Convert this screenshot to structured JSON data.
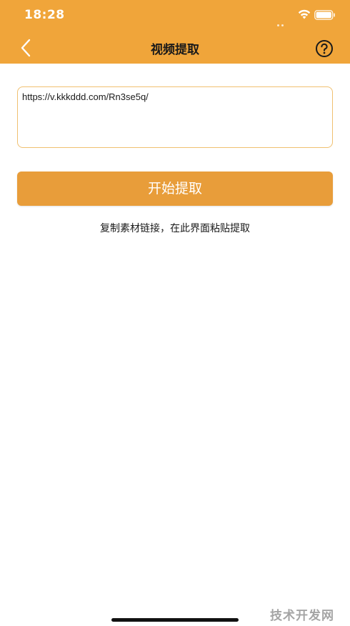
{
  "status_bar": {
    "time": "18:28",
    "wifi_icon": "wifi-icon",
    "battery_icon": "battery-icon"
  },
  "nav": {
    "title": "视频提取",
    "back_icon": "chevron-left-icon",
    "help_icon": "help-circle-icon"
  },
  "url_input": {
    "value": "https://v.kkkddd.com/Rn3se5q/"
  },
  "actions": {
    "start_label": "开始提取"
  },
  "hint": "复制素材链接，在此界面粘贴提取",
  "watermark": "技术开发网",
  "colors": {
    "header_bg": "#f0a53a",
    "button_bg": "#e89d3a",
    "input_border": "#f0c070"
  }
}
